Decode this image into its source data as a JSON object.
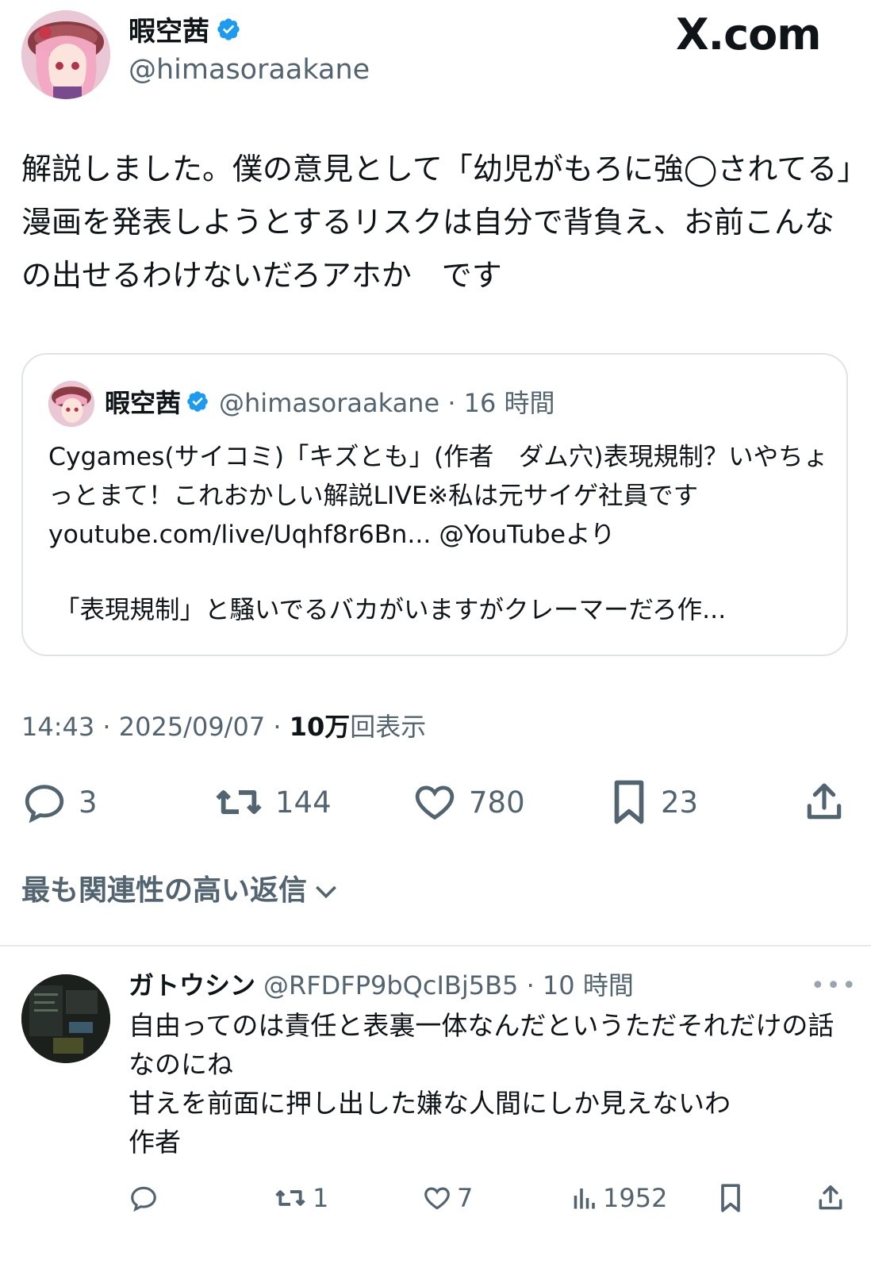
{
  "author": {
    "name": "暇空茜",
    "handle": "@himasoraakane"
  },
  "brand": {
    "logo_text": "X.com"
  },
  "tweet": {
    "text": "解説しました。僕の意見として「幼児がもろに強◯されてる」漫画を発表しようとするリスクは自分で背負え、お前こんなの出せるわけないだろアホか　です",
    "time": "14:43 · 2025/09/07 ·",
    "views_number": "10万",
    "views_label": "回表示",
    "stats": {
      "replies": "3",
      "retweets": "144",
      "likes": "780",
      "bookmarks": "23"
    }
  },
  "quote": {
    "name": "暇空茜",
    "meta": "@himasoraakane · 16 時間",
    "text": "Cygames(サイコミ)「キズとも」(作者　ダム穴)表現規制？いやちょっとまて！これおかしい解説LIVE※私は元サイゲ社員です youtube.com/live/Uqhf8r6Bn... @YouTubeより",
    "more": "「表現規制」と騒いでるバカがいますがクレーマーだろ作..."
  },
  "sort_label": "最も関連性の高い返信",
  "reply": {
    "name": "ガトウシン",
    "meta": "@RFDFP9bQcIBj5B5 · 10 時間",
    "text": "自由ってのは責任と表裏一体なんだというただそれだけの話なのにね\n甘えを前面に押し出した嫌な人間にしか見えないわ\n作者",
    "stats": {
      "retweets": "1",
      "likes": "7",
      "views": "1952"
    }
  },
  "colors": {
    "text": "#0f1419",
    "muted": "#536471",
    "verified": "#1d9bf0",
    "border": "#dfe3e6"
  }
}
